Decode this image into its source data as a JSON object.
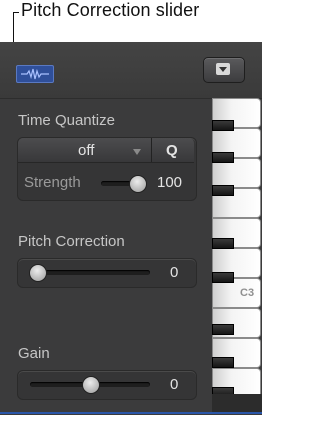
{
  "callout": {
    "text": "Pitch Correction slider"
  },
  "header": {
    "waveform_icon": "waveform-icon",
    "menu_icon": "disclosure-menu-icon"
  },
  "time_quantize": {
    "label": "Time Quantize",
    "value": "off",
    "q_button": "Q",
    "strength_label": "Strength",
    "strength_value": "100",
    "strength_level": 1.0
  },
  "pitch_correction": {
    "label": "Pitch Correction",
    "value": "0",
    "level": 0.0
  },
  "gain": {
    "label": "Gain",
    "value": "0",
    "level": 0.5
  },
  "keyboard": {
    "c3_label": "C3"
  },
  "colors": {
    "panel_bg": "#3b3b3c",
    "accent_blue": "#2f4f9a",
    "text": "#e4e4e4",
    "label": "#c6c6c6"
  }
}
